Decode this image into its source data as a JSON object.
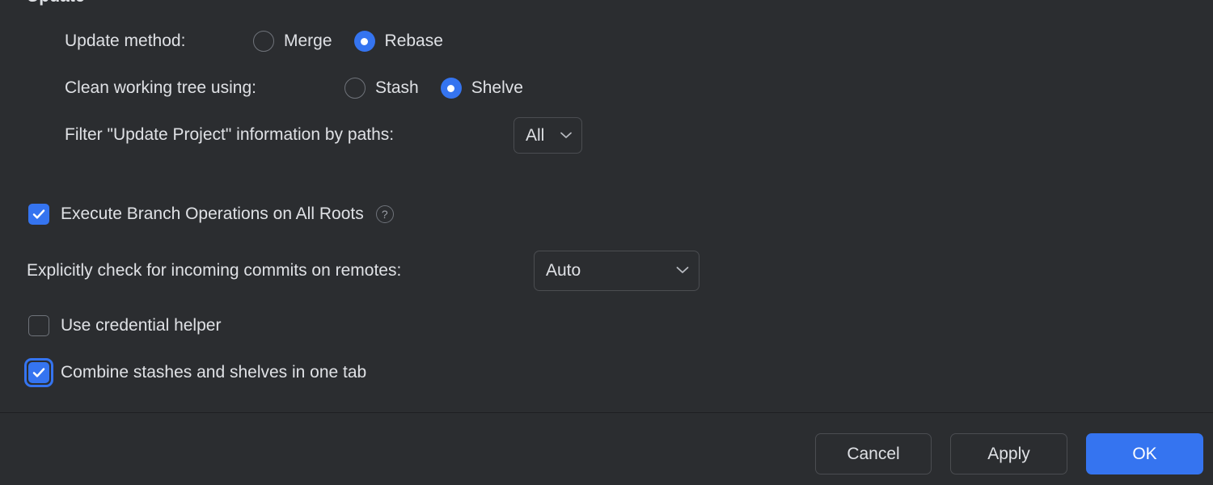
{
  "dialog": {
    "section_title": "Update",
    "background_color": "#2b2d30",
    "accent_color": "#3574f0",
    "text_color": "#dfe1e5"
  },
  "update": {
    "method": {
      "label": "Update method:",
      "options": [
        {
          "label": "Merge",
          "selected": false
        },
        {
          "label": "Rebase",
          "selected": true
        }
      ]
    },
    "clean_tree": {
      "label": "Clean working tree using:",
      "options": [
        {
          "label": "Stash",
          "selected": false
        },
        {
          "label": "Shelve",
          "selected": true
        }
      ]
    },
    "filter_paths": {
      "label": "Filter \"Update Project\" information by paths:",
      "value": "All",
      "icon": "chevron-down-icon"
    }
  },
  "options": {
    "execute_branch_ops": {
      "label": "Execute Branch Operations on All Roots",
      "checked": true,
      "help_icon": "help-circle-icon",
      "help_glyph": "?"
    },
    "incoming_commits": {
      "label": "Explicitly check for incoming commits on remotes:",
      "value": "Auto",
      "icon": "chevron-down-icon"
    },
    "credential_helper": {
      "label": "Use credential helper",
      "checked": false
    },
    "combine_stashes": {
      "label": "Combine stashes and shelves in one tab",
      "checked": true,
      "focused": true
    }
  },
  "footer": {
    "cancel_label": "Cancel",
    "apply_label": "Apply",
    "ok_label": "OK"
  }
}
